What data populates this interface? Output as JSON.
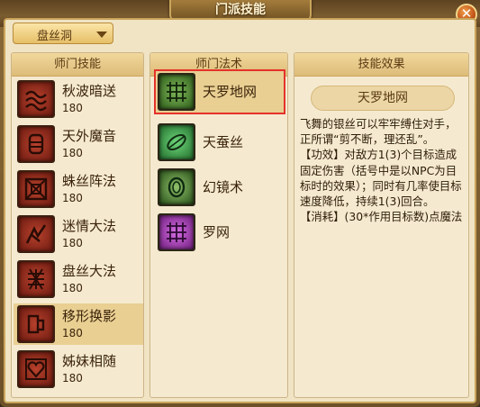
{
  "window": {
    "title": "门派技能"
  },
  "close_icon": "close-icon",
  "faction_select": {
    "value": "盘丝洞"
  },
  "columns": {
    "school_skills": "师门技能",
    "school_spells": "师门法术",
    "skill_effect": "技能效果"
  },
  "skills": [
    {
      "name": "秋波暗送",
      "level": "180",
      "icon": "wave-icon"
    },
    {
      "name": "天外魔音",
      "level": "180",
      "icon": "lantern-icon"
    },
    {
      "name": "蛛丝阵法",
      "level": "180",
      "icon": "web-formation-icon"
    },
    {
      "name": "迷情大法",
      "level": "180",
      "icon": "charm-icon"
    },
    {
      "name": "盘丝大法",
      "level": "180",
      "icon": "coil-icon"
    },
    {
      "name": "移形换影",
      "level": "180",
      "icon": "shadow-step-icon"
    },
    {
      "name": "姊妹相随",
      "level": "180",
      "icon": "heart-icon"
    }
  ],
  "selected_skill_index": 5,
  "spells": [
    {
      "name": "天罗地网",
      "icon": "net-icon",
      "color": "#3f7a2a"
    },
    {
      "name": "天蚕丝",
      "icon": "silk-icon",
      "color": "#2f8a3a"
    },
    {
      "name": "幻镜术",
      "icon": "mirror-icon",
      "color": "#2e6a2a"
    },
    {
      "name": "罗网",
      "icon": "snare-icon",
      "color": "#9a2ea8"
    }
  ],
  "selected_spell_index": 0,
  "highlight_color": "#e4322b",
  "effect": {
    "title": "天罗地网",
    "description": "飞舞的银丝可以牢牢缚住对手，正所谓“剪不断，理还乱”。\n【功效】对敌方1(3)个目标造成固定伤害（括号中是以NPC为目标时的效果）；同时有几率使目标速度降低，持续1(3)回合。\n【消耗】(30*作用目标数)点魔法"
  }
}
